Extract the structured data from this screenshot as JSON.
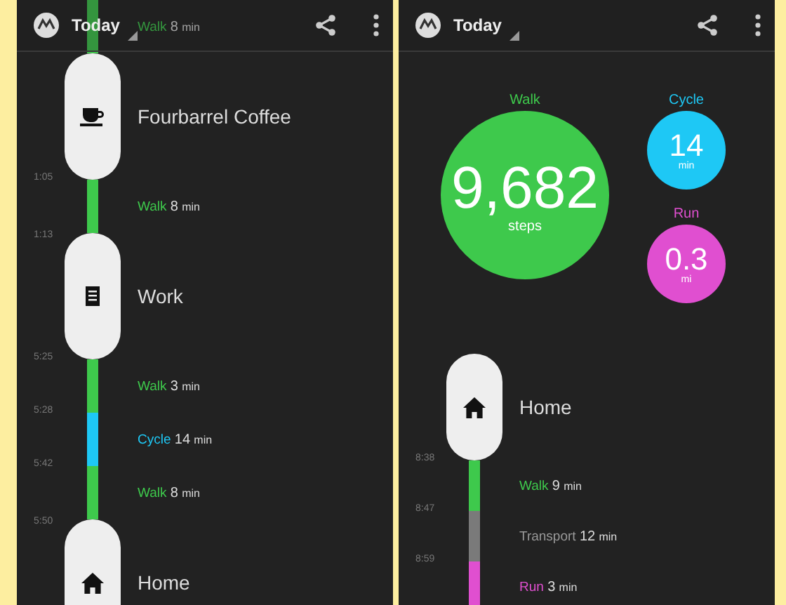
{
  "screens": [
    {
      "header": {
        "title": "Today"
      },
      "timeline": [
        {
          "kind": "segment",
          "activity": "Walk",
          "duration": "8",
          "unit": "min",
          "color": "#3ec94c"
        },
        {
          "kind": "cafe",
          "name": "Fourbarrel Coffee"
        },
        {
          "kind": "segment",
          "activity": "Walk",
          "duration": "8",
          "unit": "min",
          "color": "#3ec94c",
          "start_time": "1:05",
          "end_time": "1:13"
        },
        {
          "kind": "work",
          "name": "Work"
        },
        {
          "kind": "segment",
          "activity": "Walk",
          "duration": "3",
          "unit": "min",
          "color": "#3ec94c",
          "start_time": "5:25"
        },
        {
          "kind": "segment",
          "activity": "Cycle",
          "duration": "14",
          "unit": "min",
          "color": "#1ec8f5",
          "start_time": "5:28"
        },
        {
          "kind": "segment",
          "activity": "Walk",
          "duration": "8",
          "unit": "min",
          "color": "#3ec94c",
          "start_time": "5:42",
          "end_time": "5:50"
        },
        {
          "kind": "home",
          "name": "Home"
        }
      ]
    },
    {
      "header": {
        "title": "Today"
      },
      "summary": [
        {
          "kind": "large",
          "label": "Walk",
          "value": "9,682",
          "unit": "steps",
          "color": "#3ec94c"
        },
        {
          "kind": "small",
          "label": "Cycle",
          "value": "14",
          "unit": "min",
          "color": "#1ec8f5"
        },
        {
          "kind": "small",
          "label": "Run",
          "value": "0.3",
          "unit": "mi",
          "color": "#e04fd0"
        }
      ],
      "timeline": [
        {
          "kind": "home",
          "name": "Home"
        },
        {
          "kind": "segment",
          "activity": "Walk",
          "duration": "9",
          "unit": "min",
          "color": "#3ec94c",
          "start_time": "8:38"
        },
        {
          "kind": "segment",
          "activity": "Transport",
          "duration": "12",
          "unit": "min",
          "color": "#7a7a7a",
          "start_time": "8:47"
        },
        {
          "kind": "segment",
          "activity": "Run",
          "duration": "3",
          "unit": "min",
          "color": "#e04fd0",
          "start_time": "8:59"
        }
      ]
    }
  ]
}
